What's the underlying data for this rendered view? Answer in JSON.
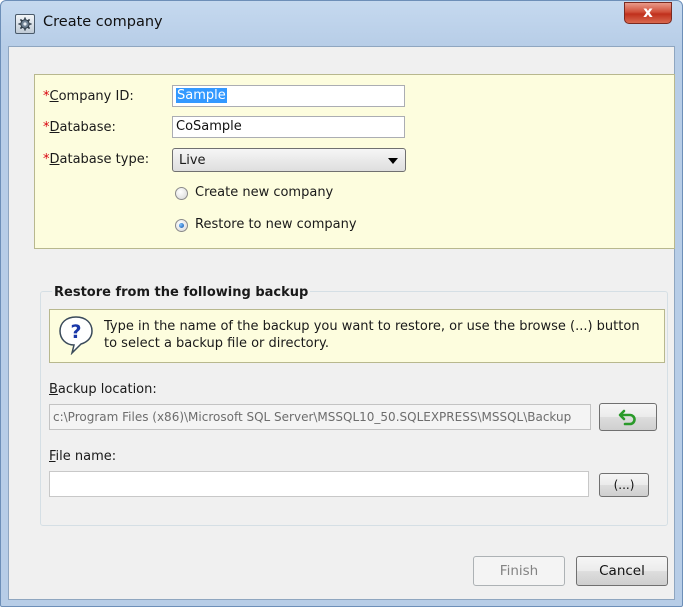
{
  "window": {
    "title": "Create company",
    "close_glyph": "x",
    "icon": "gear-window-icon"
  },
  "company": {
    "required_mark": "*",
    "id_label_key": "C",
    "id_label_rest": "ompany ID:",
    "id_value": "Sample",
    "db_label_key": "D",
    "db_label_rest": "atabase:",
    "db_value": "CoSample",
    "type_label_key": "D",
    "type_label_rest": "atabase type:",
    "type_value": "Live"
  },
  "options": {
    "create_new": "Create new company",
    "restore_new": "Restore to new company",
    "selected": "restore_new"
  },
  "restore": {
    "group_title": "Restore from the following backup",
    "info_text": "Type in the name of the backup you want to restore, or use the browse  (...) button to select a backup file or directory.",
    "backup_label_key": "B",
    "backup_label_rest": "ackup location:",
    "backup_value": "c:\\Program Files (x86)\\Microsoft SQL Server\\MSSQL10_50.SQLEXPRESS\\MSSQL\\Backup",
    "file_label_key": "F",
    "file_label_rest": "ile name:",
    "file_value": "",
    "browse_label": "(...)",
    "reset_icon": "undo-arrow-icon"
  },
  "buttons": {
    "finish": "Finish",
    "cancel": "Cancel"
  }
}
